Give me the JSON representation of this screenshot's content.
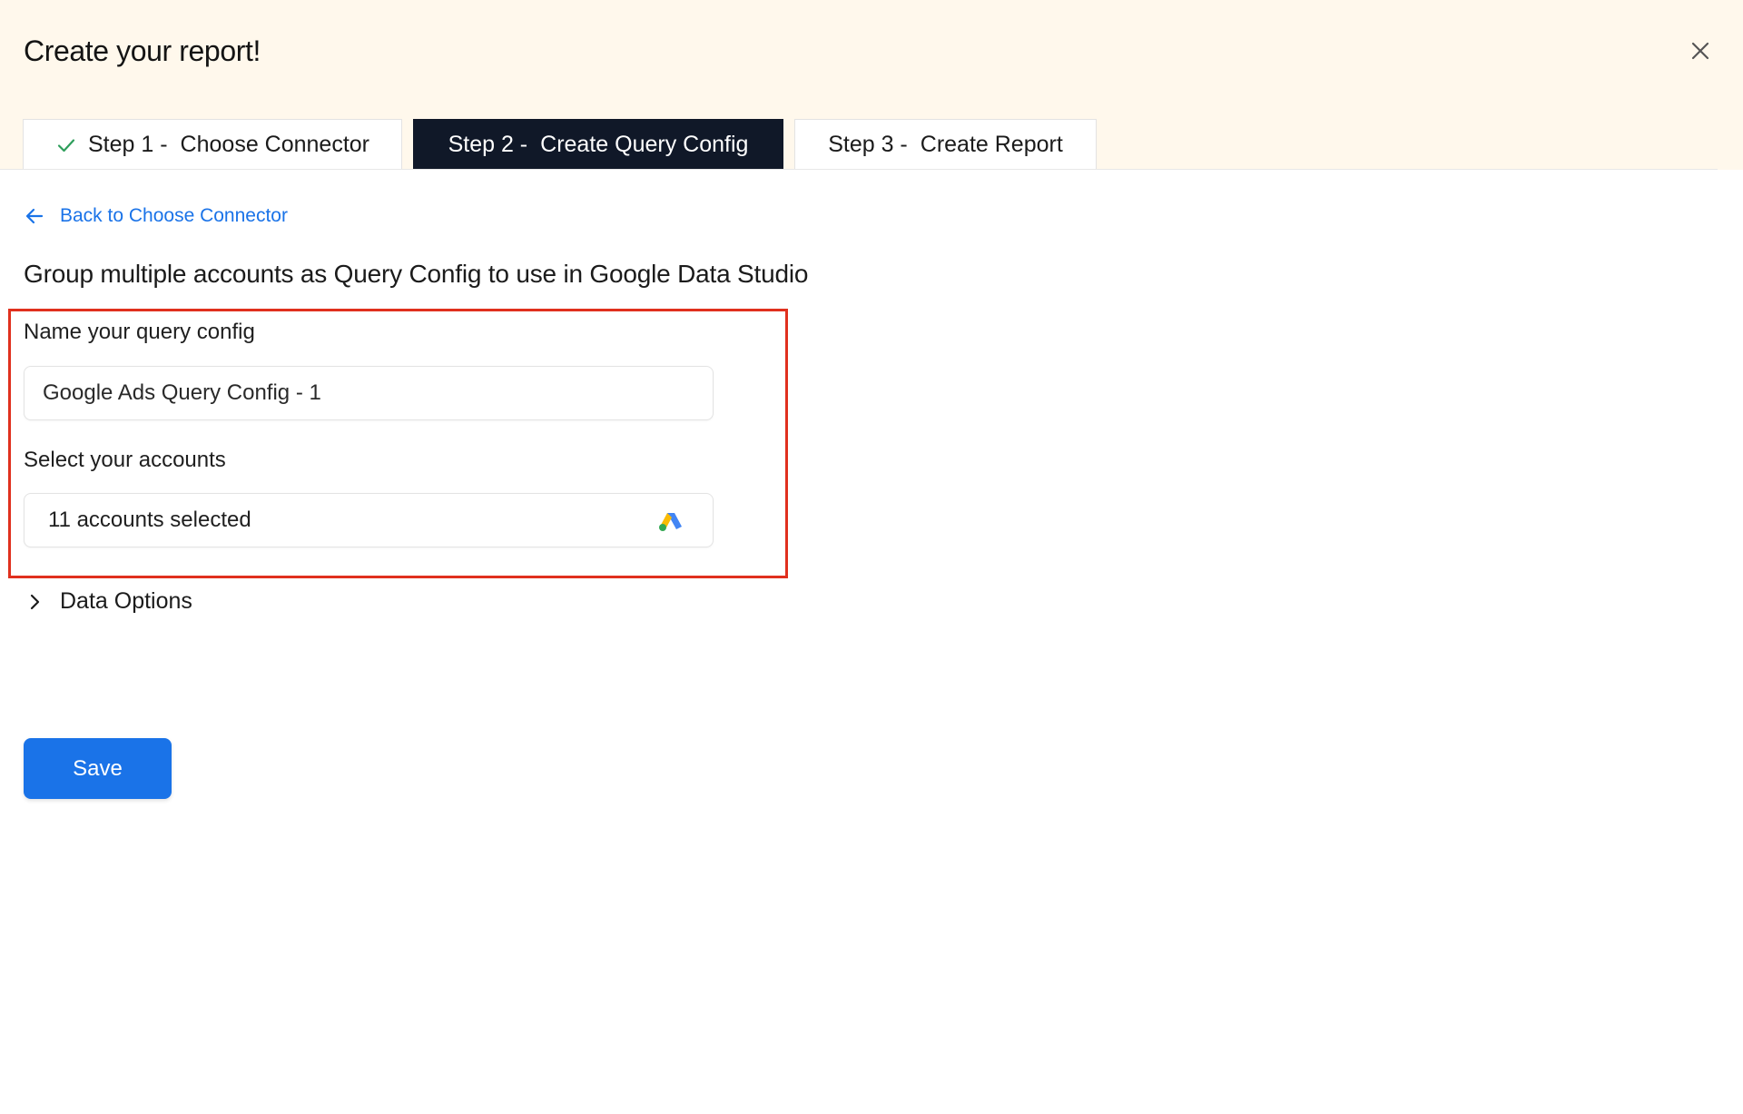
{
  "header": {
    "title": "Create your report!"
  },
  "tabs": [
    {
      "num": "Step 1 -",
      "label": "Choose Connector",
      "state": "completed"
    },
    {
      "num": "Step 2 -",
      "label": "Create Query Config",
      "state": "active"
    },
    {
      "num": "Step 3 -",
      "label": "Create Report",
      "state": "pending"
    }
  ],
  "nav": {
    "back_label": "Back to Choose Connector"
  },
  "main": {
    "heading": "Group multiple accounts as Query Config to use in Google Data Studio",
    "name_label": "Name your query config",
    "name_value": "Google Ads Query Config - 1",
    "accounts_label": "Select your accounts",
    "accounts_value": "11 accounts selected",
    "data_options_label": "Data Options",
    "save_label": "Save"
  },
  "colors": {
    "header_bg": "#fff8ec",
    "active_tab_bg": "#101828",
    "accent": "#1a73e8",
    "highlight": "#e0301e",
    "check": "#2e9e5b"
  },
  "icons": {
    "close": "close-icon",
    "check": "check-icon",
    "back": "arrow-left-icon",
    "accounts": "google-ads-icon",
    "expand": "chevron-right-icon"
  }
}
